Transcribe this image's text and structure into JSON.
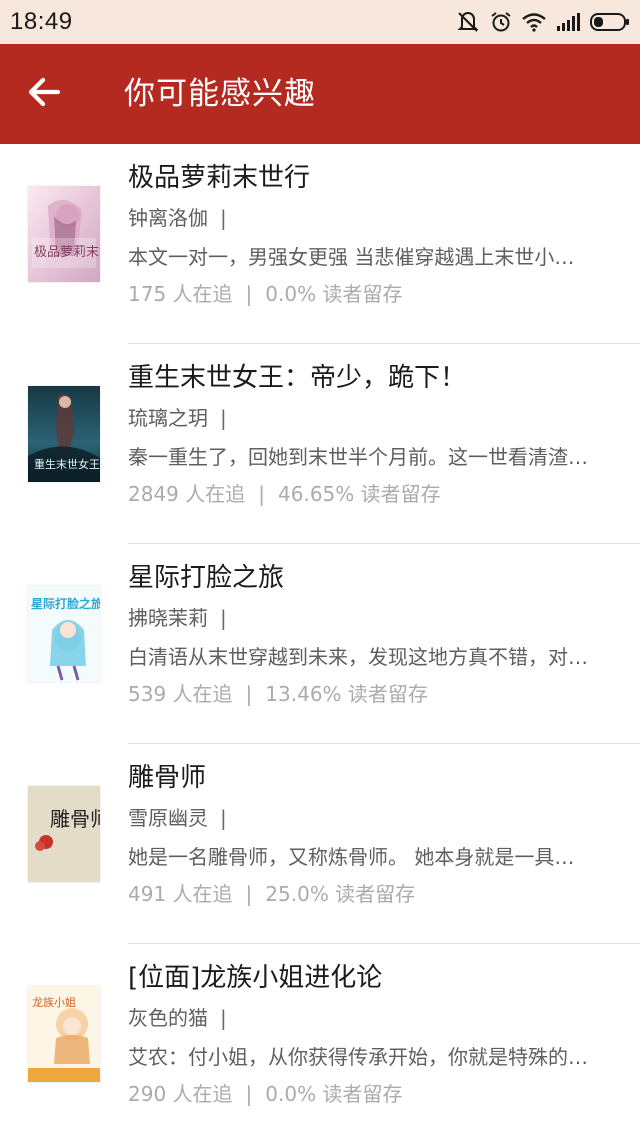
{
  "status_bar": {
    "time": "18:49",
    "icons": [
      "mute-vibrate-icon",
      "alarm-icon",
      "wifi-icon",
      "signal-icon",
      "battery-icon"
    ]
  },
  "header": {
    "back_icon": "arrow-left-icon",
    "title": "你可能感兴趣",
    "background_color": "#b52a20"
  },
  "books": [
    {
      "title": "极品萝莉末世行",
      "author": "钟离洛伽",
      "separator": "|",
      "description": "本文一对一，男强女更强 当悲催穿越遇上末世小…",
      "followers": "175 人在追",
      "retention": "0.0% 读者留存",
      "cover_text": "极品萝莉末世行"
    },
    {
      "title": "重生末世女王：帝少，跪下！",
      "author": "琉璃之玥",
      "separator": "|",
      "description": "秦一重生了，回她到末世半个月前。这一世看清渣…",
      "followers": "2849 人在追",
      "retention": "46.65% 读者留存",
      "cover_text": "重生末世女王"
    },
    {
      "title": "星际打脸之旅",
      "author": "拂晓茉莉",
      "separator": "|",
      "description": "白清语从末世穿越到未来，发现这地方真不错，对…",
      "followers": "539 人在追",
      "retention": "13.46% 读者留存",
      "cover_text": "星际打脸之旅"
    },
    {
      "title": "雕骨师",
      "author": "雪原幽灵",
      "separator": "|",
      "description": "她是一名雕骨师，又称炼骨师。 她本身就是一具…",
      "followers": "491 人在追",
      "retention": "25.0% 读者留存",
      "cover_text": "雕骨师"
    },
    {
      "title": "[位面]龙族小姐进化论",
      "author": "灰色的猫",
      "separator": "|",
      "description": "艾农：付小姐，从你获得传承开始，你就是特殊的…",
      "followers": "290 人在追",
      "retention": "0.0% 读者留存",
      "cover_text": "龙族小姐"
    }
  ],
  "stats_separator": "|"
}
